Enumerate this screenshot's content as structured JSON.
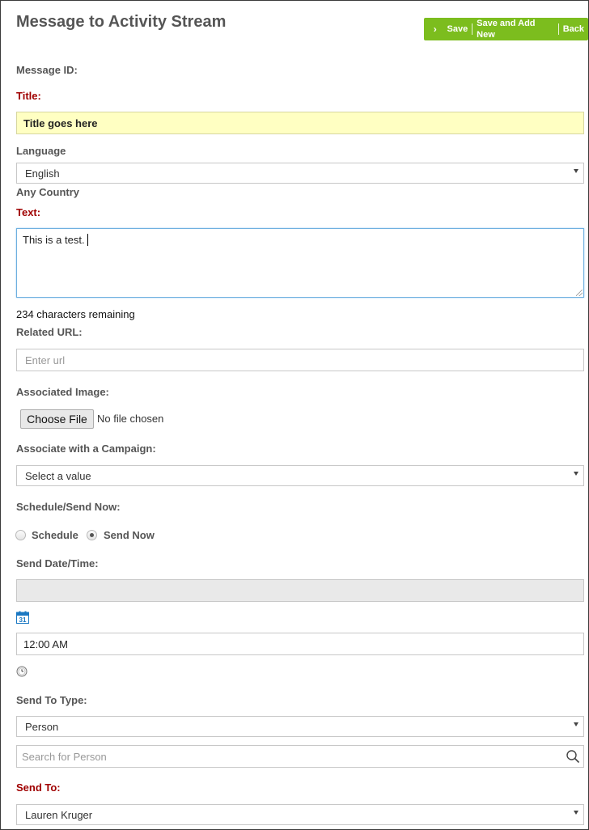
{
  "header": {
    "title": "Message to Activity Stream",
    "save": "Save",
    "save_add_new": "Save and Add New",
    "back": "Back"
  },
  "form": {
    "message_id_label": "Message ID:",
    "title_label": "Title:",
    "title_value": "Title goes here",
    "language_label": "Language",
    "language_value": "English",
    "country_text": "Any Country",
    "text_label": "Text:",
    "text_value": "This is a test.",
    "remaining": "234 characters remaining",
    "url_label": "Related URL:",
    "url_placeholder": "Enter url",
    "image_label": "Associated Image:",
    "choose_file": "Choose File",
    "no_file": "No file chosen",
    "campaign_label": "Associate with a Campaign:",
    "campaign_value": "Select a value",
    "schedule_label": "Schedule/Send Now:",
    "schedule_option": "Schedule",
    "send_now_option": "Send Now",
    "selected_option": "Send Now",
    "send_datetime_label": "Send Date/Time:",
    "send_date_value": "",
    "calendar_day": "31",
    "time_value": "12:00 AM",
    "send_to_type_label": "Send To Type:",
    "send_to_type_value": "Person",
    "person_search_placeholder": "Search for Person",
    "send_to_label": "Send To:",
    "send_to_value": "Lauren Kruger"
  },
  "colors": {
    "accent_green": "#7cbd1e",
    "required_red": "#a00000",
    "title_highlight": "#ffffc2",
    "calendar_blue": "#1a78c2"
  }
}
